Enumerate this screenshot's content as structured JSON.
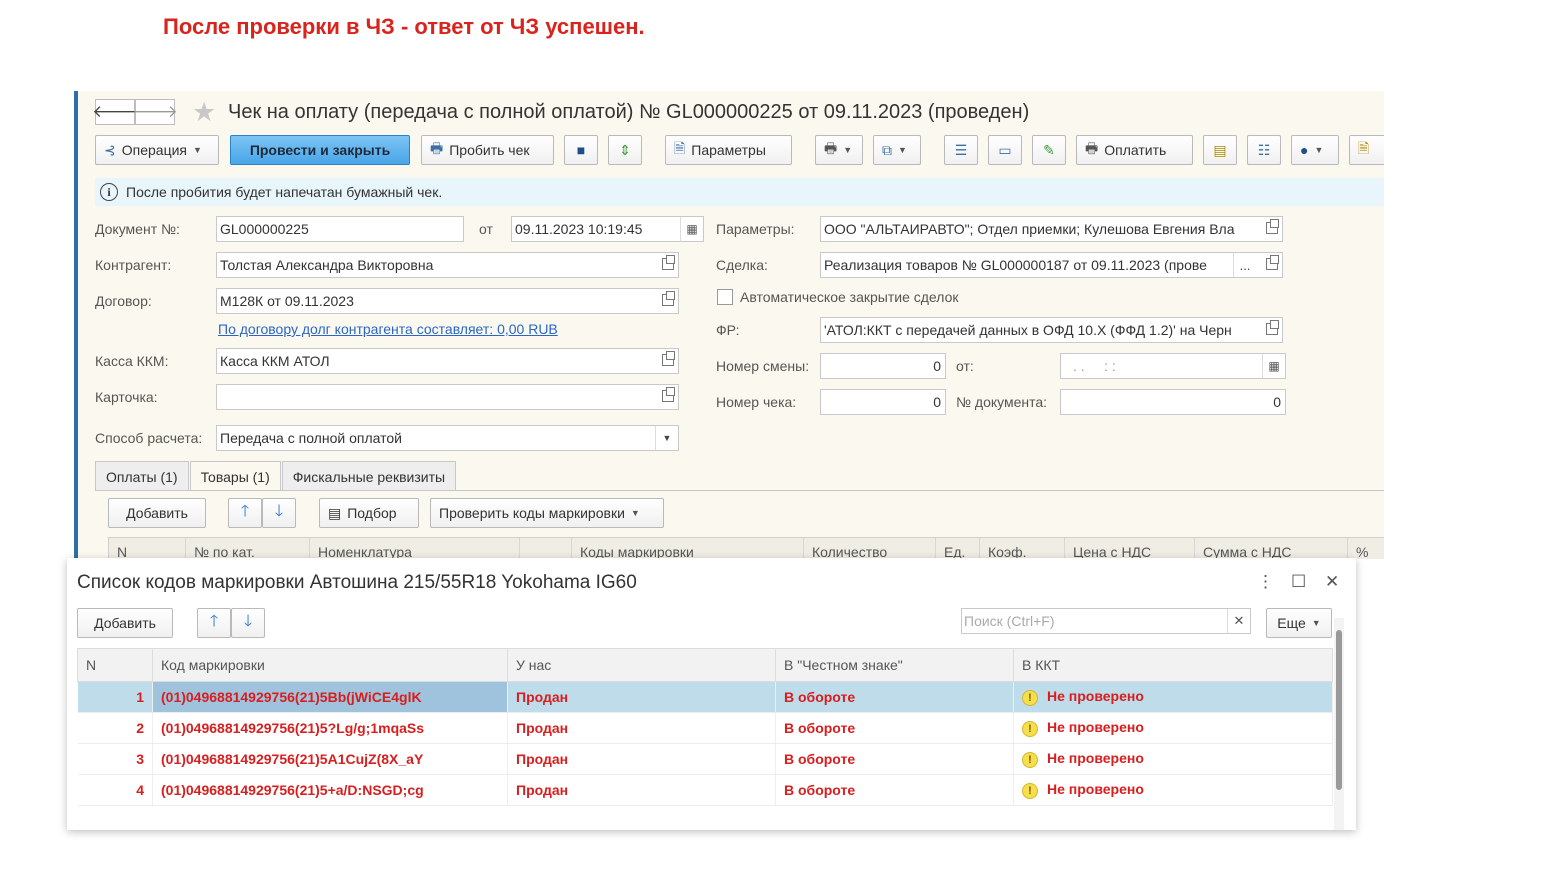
{
  "caption": "После проверки в ЧЗ - ответ от ЧЗ успешен.",
  "window": {
    "title": "Чек на оплату (передача с полной оплатой) № GL000000225 от 09.11.2023 (проведен)",
    "nav": {
      "back": "🡐",
      "forward": "🡒"
    }
  },
  "toolbar": {
    "operation": "Операция",
    "post_close": "Провести и закрыть",
    "print_receipt": "Пробить чек",
    "parameters": "Параметры",
    "pay": "Оплатить"
  },
  "info": "После пробития будет напечатан бумажный чек.",
  "form": {
    "doc_no_label": "Документ №:",
    "doc_no": "GL000000225",
    "from_label": "от",
    "date": "09.11.2023 10:19:45",
    "counterparty_label": "Контрагент:",
    "counterparty": "Толстая Александра Викторовна",
    "contract_label": "Договор:",
    "contract": "М128К от 09.11.2023",
    "debt_link": "По договору долг контрагента составляет: 0,00 RUB",
    "cash_label": "Касса ККМ:",
    "cash": "Касса ККМ АТОЛ",
    "card_label": "Карточка:",
    "card": "",
    "payment_method_label": "Способ расчета:",
    "payment_method": "Передача с полной оплатой",
    "params_label": "Параметры:",
    "params": "ООО \"АЛЬТАИРАВТО\"; Отдел приемки; Кулешова Евгения Вла",
    "deal_label": "Сделка:",
    "deal": "Реализация товаров № GL000000187 от 09.11.2023 (прове",
    "auto_close_label": "Автоматическое закрытие сделок",
    "fr_label": "ФР:",
    "fr": "'АТОЛ:ККТ с передачей данных в ОФД 10.X (ФФД 1.2)' на Черн",
    "shift_label": "Номер смены:",
    "shift": "0",
    "shift_from_label": "от:",
    "shift_date": ". .     : :",
    "check_no_label": "Номер чека:",
    "check_no": "0",
    "doc_num_label": "№ документа:",
    "doc_num": "0"
  },
  "tabs": [
    "Оплаты (1)",
    "Товары (1)",
    "Фискальные реквизиты"
  ],
  "goods_toolbar": {
    "add": "Добавить",
    "select": "Подбор",
    "check_codes": "Проверить коды маркировки"
  },
  "goods_columns": [
    "N",
    "№ по кат.",
    "Номенклатура",
    "Коды маркировки",
    "Количество",
    "Ед.",
    "Коэф.",
    "Цена с НДС",
    "Сумма с НДС",
    "%"
  ],
  "modal": {
    "title": "Список кодов маркировки Автошина 215/55R18 Yokohama IG60",
    "add": "Добавить",
    "search_placeholder": "Поиск (Ctrl+F)",
    "more": "Еще",
    "columns": [
      "N",
      "Код маркировки",
      "У нас",
      "В \"Честном знаке\"",
      "В ККТ"
    ],
    "rows": [
      {
        "n": "1",
        "code": "(01)04968814929756(21)5Bb(jWiCE4glK",
        "ours": "Продан",
        "cz": "В обороте",
        "kkt": "Не проверено"
      },
      {
        "n": "2",
        "code": "(01)04968814929756(21)5?Lg/g;1mqaSs",
        "ours": "Продан",
        "cz": "В обороте",
        "kkt": "Не проверено"
      },
      {
        "n": "3",
        "code": "(01)04968814929756(21)5A1CujZ(8X_aY",
        "ours": "Продан",
        "cz": "В обороте",
        "kkt": "Не проверено"
      },
      {
        "n": "4",
        "code": "(01)04968814929756(21)5+a/D:NSGD;cg",
        "ours": "Продан",
        "cz": "В обороте",
        "kkt": "Не проверено"
      }
    ]
  },
  "colors": {
    "caption": "#d9231d",
    "status": "#d81e1e",
    "primary_button": "#4aa5e8",
    "selected_row": "#bfdcea"
  }
}
